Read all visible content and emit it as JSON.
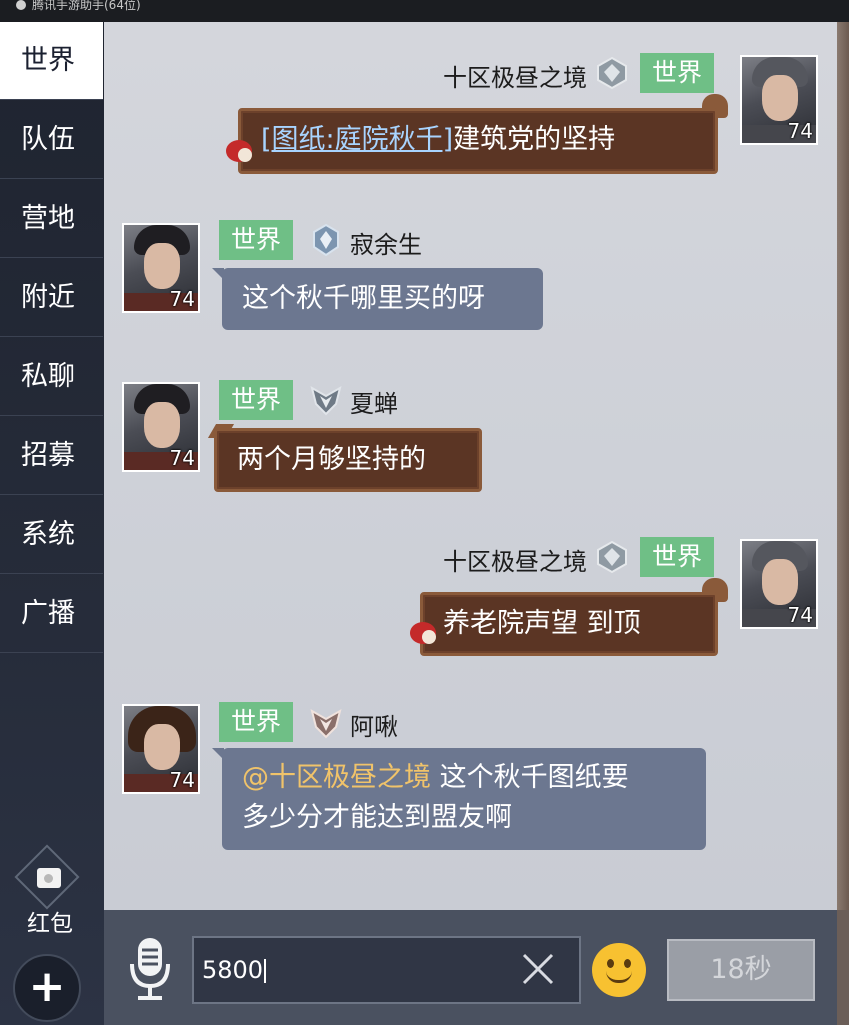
{
  "top_bar": {
    "title": "腾讯手游助手(64位)"
  },
  "sidebar": {
    "tabs": [
      {
        "label": "世界",
        "active": true
      },
      {
        "label": "队伍"
      },
      {
        "label": "营地"
      },
      {
        "label": "附近"
      },
      {
        "label": "私聊"
      },
      {
        "label": "招募"
      },
      {
        "label": "系统"
      },
      {
        "label": "广播"
      }
    ],
    "red_packet_label": "红包",
    "plus_label": "+"
  },
  "messages": [
    {
      "side": "right",
      "sender": "十区极昼之境",
      "channel": "世界",
      "level": "74",
      "text_link": "[图纸:庭院秋千]",
      "text": "建筑党的坚持",
      "bubble": "wood"
    },
    {
      "side": "left",
      "sender": "寂余生",
      "channel": "世界",
      "level": "74",
      "text": "这个秋千哪里买的呀",
      "bubble": "grey"
    },
    {
      "side": "left",
      "sender": "夏蝉",
      "channel": "世界",
      "level": "74",
      "text": "两个月够坚持的",
      "bubble": "wood"
    },
    {
      "side": "right",
      "sender": "十区极昼之境",
      "channel": "世界",
      "level": "74",
      "text": "养老院声望 到顶",
      "bubble": "wood"
    },
    {
      "side": "left",
      "sender": "阿啾",
      "channel": "世界",
      "level": "74",
      "mention": "@十区极昼之境",
      "text_line1": " 这个秋千图纸要",
      "text_line2": "多少分才能达到盟友啊",
      "bubble": "grey"
    }
  ],
  "input": {
    "value": "5800",
    "clear_icon": "close-icon"
  },
  "send_button": {
    "label": "18秒"
  },
  "colors": {
    "channel_badge": "#6fbf86",
    "grey_bubble": "#6c7790",
    "wood_bubble": "#5b3524",
    "mention": "#f0c36a",
    "link": "#a8d4ff"
  }
}
